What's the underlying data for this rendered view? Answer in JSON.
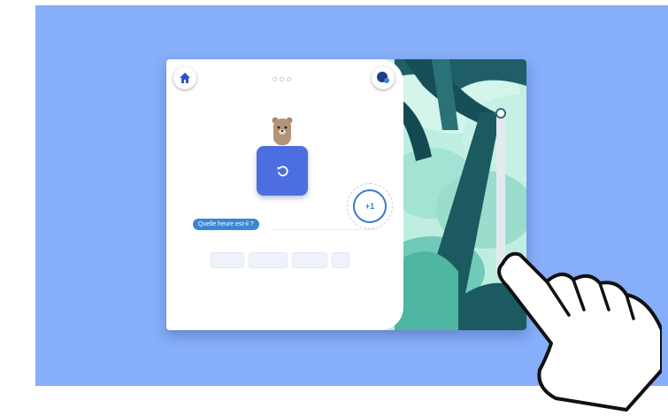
{
  "app": {
    "prompt_text": "Quelle heure est-il ?",
    "points_label": "+1",
    "page_indicator_count": 3,
    "answer_tile_count": 4
  },
  "icons": {
    "home": "home-icon",
    "profile": "profile-icon",
    "undo": "undo-icon",
    "character": "bear-character-icon",
    "hand": "pointing-hand-icon"
  },
  "colors": {
    "background": "#86aef9",
    "card": "#4d6ee0",
    "bubble": "#3a86d2",
    "accent": "#3a79c9",
    "forest": "#5fc1b1"
  },
  "slider": {
    "level": 1.0
  }
}
